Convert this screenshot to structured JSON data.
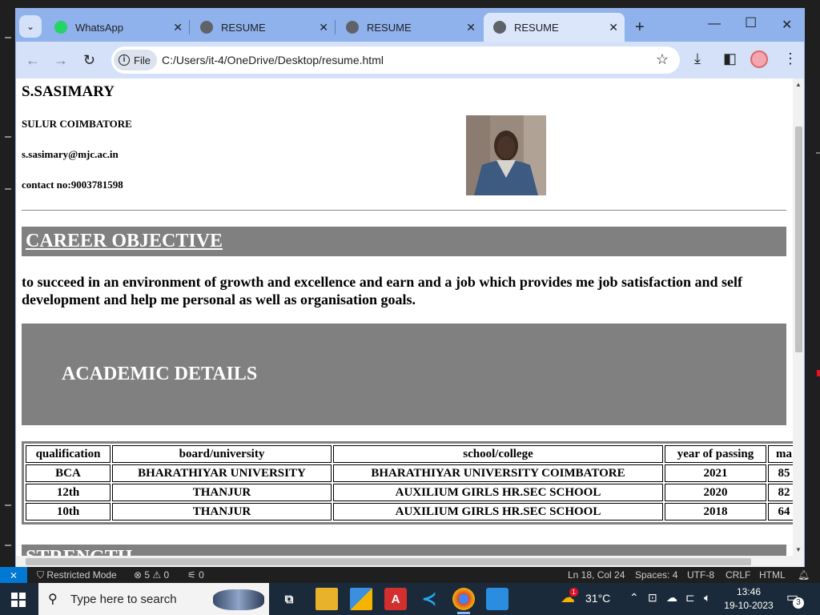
{
  "browser": {
    "tabs": [
      {
        "title": "WhatsApp",
        "icon": "whatsapp-icon"
      },
      {
        "title": "RESUME",
        "icon": "globe-icon"
      },
      {
        "title": "RESUME",
        "icon": "globe-icon"
      },
      {
        "title": "RESUME",
        "icon": "globe-icon",
        "active": true
      }
    ],
    "address": {
      "chip": "File",
      "url": "C:/Users/it-4/OneDrive/Desktop/resume.html"
    }
  },
  "resume": {
    "name": "S.SASIMARY",
    "location": "SULUR COIMBATORE",
    "email": "s.sasimary@mjc.ac.in",
    "contact": "contact no:9003781598",
    "career_heading": "CAREER OBJECTIVE",
    "objective": "to succeed in an environment of growth and excellence and earn and a job which provides me job satisfaction and self development and help me personal as well as organisation goals.",
    "academic_heading": "ACADEMIC DETAILS",
    "table": {
      "headers": [
        "qualification",
        "board/university",
        "school/college",
        "year of passing",
        "ma"
      ],
      "rows": [
        [
          "BCA",
          "BHARATHIYAR UNIVERSITY",
          "BHARATHIYAR UNIVERSITY COIMBATORE",
          "2021",
          "85"
        ],
        [
          "12th",
          "THANJUR",
          "AUXILIUM GIRLS HR.SEC SCHOOL",
          "2020",
          "82"
        ],
        [
          "10th",
          "THANJUR",
          "AUXILIUM GIRLS HR.SEC SCHOOL",
          "2018",
          "64"
        ]
      ]
    },
    "strength_heading": "STRENGTH"
  },
  "statusbar": {
    "mode": "Restricted Mode",
    "errors": "5",
    "warnings": "0",
    "ports": "0",
    "cursor": "Ln 18, Col 24",
    "spaces": "Spaces: 4",
    "encoding": "UTF-8",
    "eol": "CRLF",
    "language": "HTML"
  },
  "taskbar": {
    "search_placeholder": "Type here to search",
    "weather": "31°C",
    "weather_badge": "1",
    "time": "13:46",
    "date": "19-10-2023",
    "notifications": "3"
  },
  "colors": {
    "tabbar": "#8fb1ec",
    "toolbar": "#d4e1f8",
    "banner": "#808080",
    "taskbar": "#1b2a3a",
    "vscode_blue": "#0078d4"
  }
}
